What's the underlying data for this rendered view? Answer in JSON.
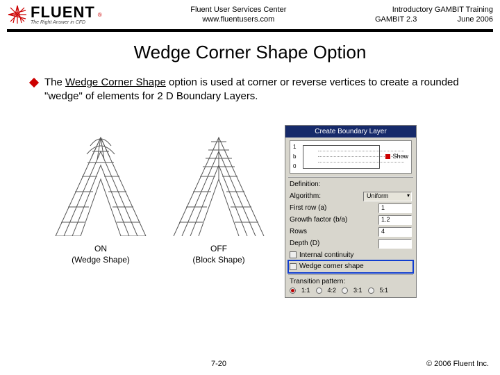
{
  "header": {
    "brand": "FLUENT",
    "tagline": "The Right Answer in CFD",
    "center_line1": "Fluent User Services Center",
    "center_line2": "www.fluentusers.com",
    "right_line1": "Introductory GAMBIT Training",
    "right_line2_left": "GAMBIT 2.3",
    "right_line2_right": "June 2006"
  },
  "title": "Wedge Corner Shape Option",
  "bullet": {
    "pre": "The ",
    "u": "Wedge Corner Shape",
    "post": " option is used at corner or reverse vertices to create a rounded \"wedge\" of elements for 2 D Boundary Layers."
  },
  "diag": {
    "on_l1": "ON",
    "on_l2": "(Wedge Shape)",
    "off_l1": "OFF",
    "off_l2": "(Block Shape)"
  },
  "panel": {
    "title": "Create Boundary Layer",
    "show": "Show",
    "axis_a": "1",
    "axis_b": "b",
    "axis_c": "0",
    "def": "Definition:",
    "algo_lbl": "Algorithm:",
    "algo_val": "Uniform",
    "first_lbl": "First row (a)",
    "first_val": "1",
    "growth_lbl": "Growth factor (b/a)",
    "growth_val": "1.2",
    "rows_lbl": "Rows",
    "rows_val": "4",
    "depth_lbl": "Depth (D)",
    "internal": "Internal continuity",
    "wedge": "Wedge corner shape",
    "trans_lbl": "Transition pattern:",
    "p1": "1:1",
    "p2": "4:2",
    "p3": "3:1",
    "p4": "5:1"
  },
  "footer": {
    "page": "7-20",
    "copy": "© 2006 Fluent Inc."
  }
}
